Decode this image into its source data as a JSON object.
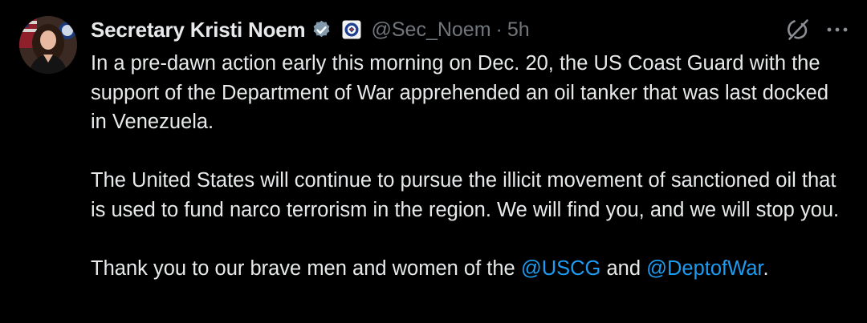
{
  "tweet": {
    "display_name": "Secretary Kristi Noem",
    "handle": "@Sec_Noem",
    "separator": "·",
    "time": "5h",
    "paragraph1": "In a pre-dawn action early this morning on Dec. 20, the US Coast Guard with the support of the Department of War apprehended an oil tanker that was last docked in Venezuela.",
    "paragraph2": "The United States will continue to pursue the illicit movement of sanctioned oil that is used to fund narco terrorism in the region. We will find you, and we will stop you.",
    "paragraph3_prefix": "Thank you to our brave men and women of the ",
    "mention1": "@USCG",
    "paragraph3_middle": " and ",
    "mention2": "@DeptofWar",
    "paragraph3_suffix": "."
  },
  "icons": {
    "verified": "verified-badge-icon",
    "affiliation": "dhs-seal-icon",
    "grok": "grok-icon",
    "more": "more-icon"
  },
  "colors": {
    "background": "#000000",
    "text": "#e7e9ea",
    "secondary": "#71767b",
    "accent": "#1d9bf0"
  }
}
